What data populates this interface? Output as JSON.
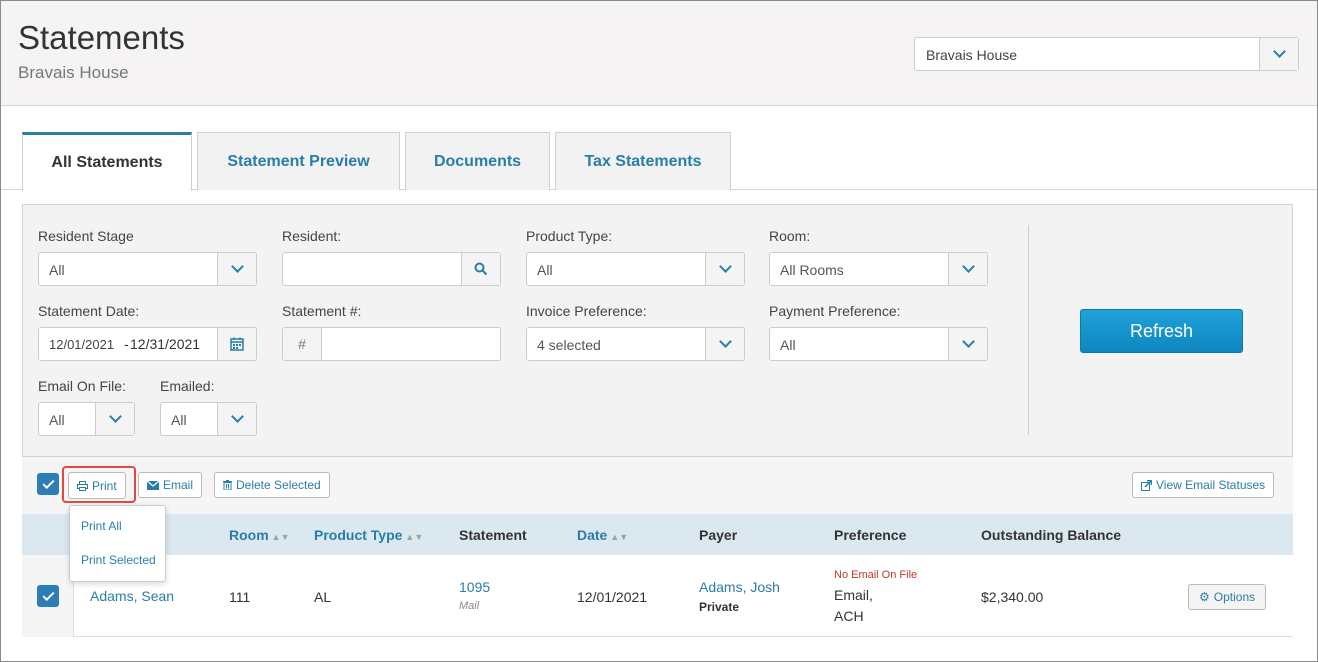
{
  "header": {
    "title": "Statements",
    "subtitle": "Bravais House",
    "community_select": "Bravais House"
  },
  "tabs": [
    {
      "label": "All Statements",
      "active": true
    },
    {
      "label": "Statement Preview",
      "active": false
    },
    {
      "label": "Documents",
      "active": false
    },
    {
      "label": "Tax Statements",
      "active": false
    }
  ],
  "filters": {
    "resident_stage": {
      "label": "Resident Stage",
      "value": "All"
    },
    "resident": {
      "label": "Resident:",
      "value": ""
    },
    "product_type": {
      "label": "Product Type:",
      "value": "All"
    },
    "room": {
      "label": "Room:",
      "value": "All Rooms"
    },
    "statement_date": {
      "label": "Statement Date:",
      "from": "12/01/2021",
      "to": "12/31/2021"
    },
    "statement_number": {
      "label": "Statement #:",
      "prefix": "#",
      "value": ""
    },
    "invoice_preference": {
      "label": "Invoice Preference:",
      "value": "4 selected"
    },
    "payment_preference": {
      "label": "Payment Preference:",
      "value": "All"
    },
    "email_on_file": {
      "label": "Email On File:",
      "value": "All"
    },
    "emailed": {
      "label": "Emailed:",
      "value": "All"
    },
    "refresh_label": "Refresh"
  },
  "toolbar": {
    "print_label": "Print",
    "email_label": "Email",
    "delete_label": "Delete Selected",
    "view_email_statuses_label": "View Email Statuses"
  },
  "print_menu": {
    "items": [
      "Print All",
      "Print Selected"
    ]
  },
  "table": {
    "columns": [
      "Room",
      "Product Type",
      "Statement",
      "Date",
      "Payer",
      "Preference",
      "Outstanding Balance"
    ],
    "rows": [
      {
        "resident": "Adams, Sean",
        "room": "111",
        "product_type": "AL",
        "statement": "1095",
        "statement_method": "Mail",
        "date": "12/01/2021",
        "payer": "Adams, Josh",
        "payer_type": "Private",
        "preference_warning": "No Email On File",
        "preference_line1": "Email,",
        "preference_line2": "ACH",
        "balance": "$2,340.00",
        "options_label": "Options"
      }
    ]
  },
  "colors": {
    "accent": "#2a7da8",
    "primary_button": "#1493cc",
    "warning": "#c0392b",
    "highlight": "#e04848"
  }
}
